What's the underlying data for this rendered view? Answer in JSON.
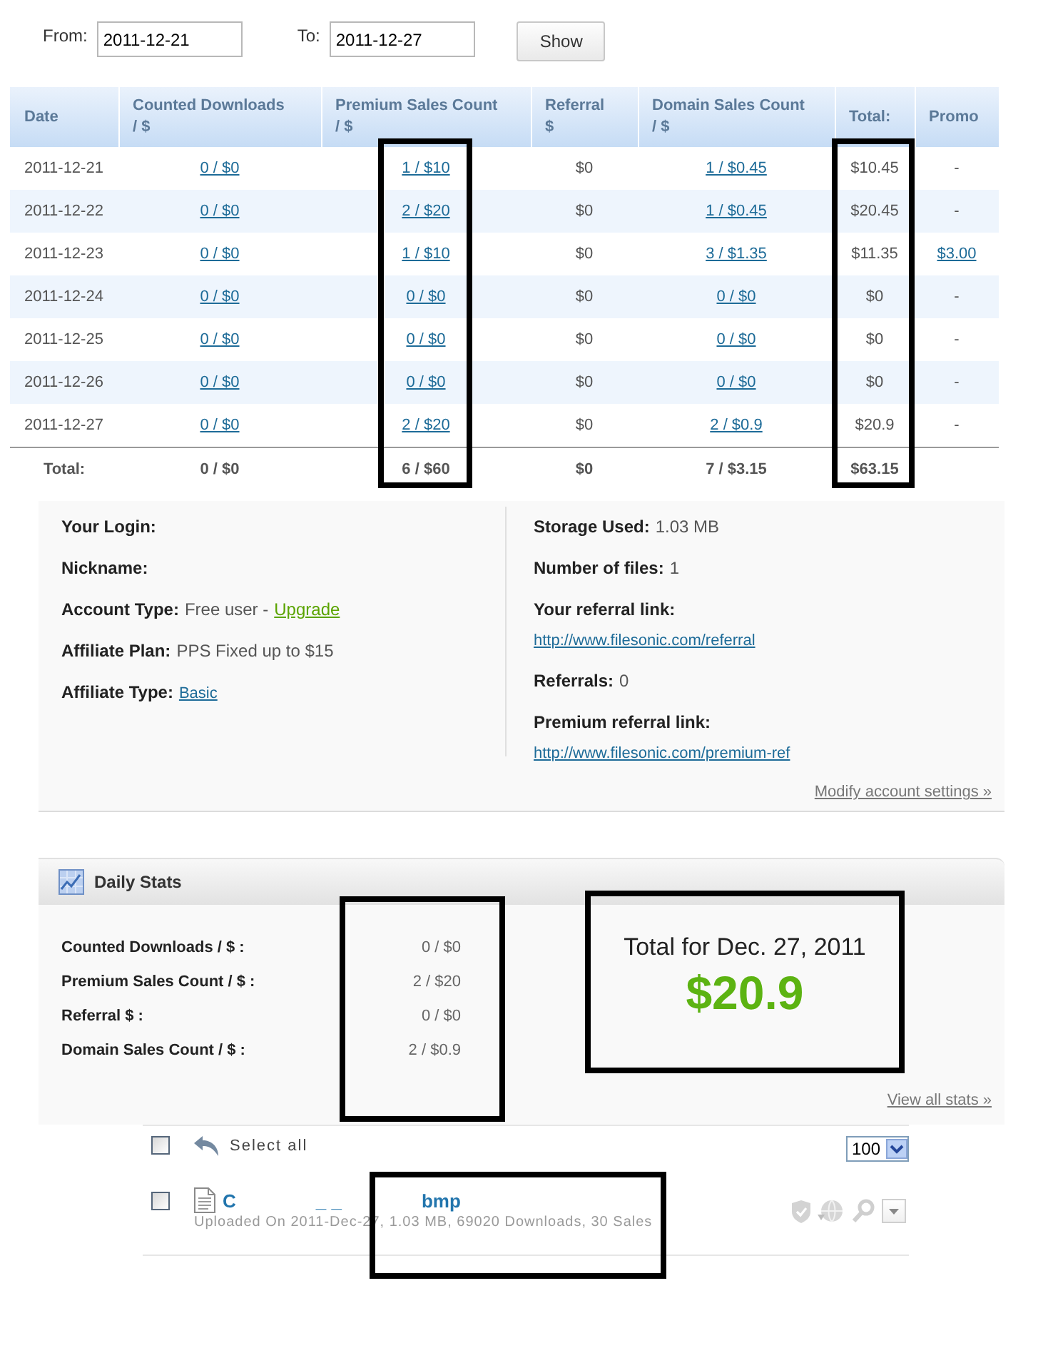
{
  "filter": {
    "from_label": "From:",
    "from_value": "2011-12-21",
    "to_label": "To:",
    "to_value": "2011-12-27",
    "button": "Show"
  },
  "table": {
    "columns": [
      {
        "label": "Date",
        "highlighted": false
      },
      {
        "label": "Counted Downloads",
        "sub": "/ $",
        "highlighted": false
      },
      {
        "label": "Premium Sales Count",
        "sub": "/ $",
        "highlighted": true
      },
      {
        "label": "Referral",
        "sub": "$",
        "highlighted": false
      },
      {
        "label": "Domain Sales Count",
        "sub": "/ $",
        "highlighted": false
      },
      {
        "label": "Total:",
        "highlighted": true
      },
      {
        "label": "Promo",
        "highlighted": false
      }
    ],
    "rows": [
      {
        "cells": [
          {
            "text": "2011-12-21",
            "kind": "text"
          },
          {
            "text": "0 / $0",
            "kind": "link"
          },
          {
            "text": "1 / $10",
            "kind": "link"
          },
          {
            "text": "$0",
            "kind": "text"
          },
          {
            "text": "1 / $0.45",
            "kind": "link"
          },
          {
            "text": "$10.45",
            "kind": "text"
          },
          {
            "text": "-",
            "kind": "text"
          }
        ]
      },
      {
        "cells": [
          {
            "text": "2011-12-22",
            "kind": "text"
          },
          {
            "text": "0 / $0",
            "kind": "link"
          },
          {
            "text": "2 / $20",
            "kind": "link"
          },
          {
            "text": "$0",
            "kind": "text"
          },
          {
            "text": "1 / $0.45",
            "kind": "link"
          },
          {
            "text": "$20.45",
            "kind": "text"
          },
          {
            "text": "-",
            "kind": "text"
          }
        ]
      },
      {
        "cells": [
          {
            "text": "2011-12-23",
            "kind": "text"
          },
          {
            "text": "0 / $0",
            "kind": "link"
          },
          {
            "text": "1 / $10",
            "kind": "link"
          },
          {
            "text": "$0",
            "kind": "text"
          },
          {
            "text": "3 / $1.35",
            "kind": "link"
          },
          {
            "text": "$11.35",
            "kind": "text"
          },
          {
            "text": "$3.00",
            "kind": "link"
          }
        ]
      },
      {
        "cells": [
          {
            "text": "2011-12-24",
            "kind": "text"
          },
          {
            "text": "0 / $0",
            "kind": "link"
          },
          {
            "text": "0 / $0",
            "kind": "link"
          },
          {
            "text": "$0",
            "kind": "text"
          },
          {
            "text": "0 / $0",
            "kind": "link"
          },
          {
            "text": "$0",
            "kind": "text"
          },
          {
            "text": "-",
            "kind": "text"
          }
        ]
      },
      {
        "cells": [
          {
            "text": "2011-12-25",
            "kind": "text"
          },
          {
            "text": "0 / $0",
            "kind": "link"
          },
          {
            "text": "0 / $0",
            "kind": "link"
          },
          {
            "text": "$0",
            "kind": "text"
          },
          {
            "text": "0 / $0",
            "kind": "link"
          },
          {
            "text": "$0",
            "kind": "text"
          },
          {
            "text": "-",
            "kind": "text"
          }
        ]
      },
      {
        "cells": [
          {
            "text": "2011-12-26",
            "kind": "text"
          },
          {
            "text": "0 / $0",
            "kind": "link"
          },
          {
            "text": "0 / $0",
            "kind": "link"
          },
          {
            "text": "$0",
            "kind": "text"
          },
          {
            "text": "0 / $0",
            "kind": "link"
          },
          {
            "text": "$0",
            "kind": "text"
          },
          {
            "text": "-",
            "kind": "text"
          }
        ]
      },
      {
        "cells": [
          {
            "text": "2011-12-27",
            "kind": "text"
          },
          {
            "text": "0 / $0",
            "kind": "link"
          },
          {
            "text": "2 / $20",
            "kind": "link"
          },
          {
            "text": "$0",
            "kind": "text"
          },
          {
            "text": "2 / $0.9",
            "kind": "link"
          },
          {
            "text": "$20.9",
            "kind": "text"
          },
          {
            "text": "-",
            "kind": "text"
          }
        ]
      }
    ],
    "totals": [
      "Total:",
      "0 / $0",
      "6 / $60",
      "$0",
      "7 / $3.15",
      "$63.15"
    ]
  },
  "account": {
    "left": [
      {
        "kind": "inline",
        "label": "Your Login:"
      },
      {
        "kind": "inline",
        "label": "Nickname:"
      },
      {
        "kind": "inline",
        "label": "Account Type:",
        "value": "Free user -",
        "link": {
          "text": "Upgrade",
          "kind": "upgrade"
        }
      },
      {
        "kind": "inline",
        "label": "Affiliate Plan:",
        "value": "PPS Fixed up to $15"
      },
      {
        "kind": "inline",
        "label": "Affiliate Type:",
        "link": {
          "text": "Basic",
          "kind": "normal"
        }
      }
    ],
    "right": [
      {
        "kind": "inline",
        "label": "Storage Used:",
        "value": "1.03 MB"
      },
      {
        "kind": "inline",
        "label": "Number of files:",
        "value": "1"
      },
      {
        "kind": "stacked",
        "label": "Your referral link:",
        "link": {
          "text": "http://www.filesonic.com/referral",
          "kind": "normal"
        }
      },
      {
        "kind": "inline",
        "label": "Referrals:",
        "value": "0"
      },
      {
        "kind": "stacked",
        "label": "Premium referral link:",
        "link": {
          "text": "http://www.filesonic.com/premium-ref",
          "kind": "normal"
        }
      }
    ],
    "settings_link": "Modify account settings »"
  },
  "daily_stats": {
    "title": "Daily Stats",
    "rows": [
      {
        "label": "Counted Downloads / $ :",
        "value": "0 / $0"
      },
      {
        "label": "Premium Sales Count / $ :",
        "value": "2 / $20"
      },
      {
        "label": "Referral $ :",
        "value": "0 / $0"
      },
      {
        "label": "Domain Sales Count / $ :",
        "value": "2 / $0.9"
      }
    ],
    "values_highlighted": true,
    "total_label": "Total for Dec. 27, 2011",
    "total_value": "$20.9",
    "total_highlighted": true,
    "link": "View all stats »"
  },
  "file_list": {
    "select_all": {
      "label": "Select all",
      "checked": false
    },
    "per_page": "100",
    "files": [
      {
        "name_parts": [
          "C",
          "_ _",
          "bmp"
        ],
        "meta": "Uploaded On 2011-Dec-27, 1.03 MB, 69020 Downloads, 30 Sales",
        "checked": false,
        "highlighted": true
      }
    ]
  }
}
